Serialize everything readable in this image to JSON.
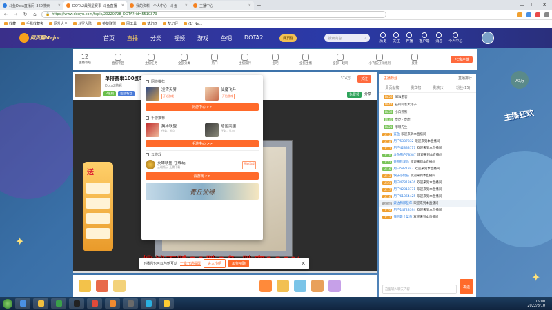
{
  "browser": {
    "tabs": [
      {
        "title": "斗鱼Dota直播间_360搜索",
        "active": false
      },
      {
        "title": "DOTA2最明星赛事_斗鱼直播",
        "active": true
      },
      {
        "title": "我的资料 - 个人中心 - 斗鱼",
        "active": false
      },
      {
        "title": "主播中心",
        "active": false
      }
    ],
    "url": "https://www.douyu.com/topic/20220728_DOTA?rid=5510379",
    "bookmarks": [
      "收藏",
      "手机收藏夹",
      "网址大全",
      "斗罗大陆",
      "英雄联盟",
      "图工具",
      "梦幻西",
      "梦幻经",
      "(1) Ne..."
    ]
  },
  "site": {
    "logo_text": "网页翻Major",
    "nav": [
      "首页",
      "直播",
      "分类",
      "视频",
      "游戏",
      "鱼吧",
      "DOTA2"
    ],
    "nav_active": "直播",
    "vip_pill": "网页翻",
    "search_placeholder": "搜索内容",
    "top_icons": [
      "历史",
      "关注",
      "开播",
      "客户端",
      "消息",
      "个人中心"
    ]
  },
  "substrip": {
    "items": [
      {
        "value": "12",
        "label": "主播等级"
      },
      {
        "value": "",
        "label": "直播专区"
      },
      {
        "value": "",
        "label": "主播任务"
      },
      {
        "value": "",
        "label": "全部分类"
      },
      {
        "value": "",
        "label": "热门"
      },
      {
        "value": "",
        "label": "主播排行"
      },
      {
        "value": "",
        "label": "鱼吧"
      },
      {
        "value": "",
        "label": "全民主播"
      },
      {
        "value": "",
        "label": "全部一起玩"
      },
      {
        "value": "",
        "label": "小飞猫分润规则"
      },
      {
        "value": "",
        "label": "反馈"
      },
      {
        "value": "",
        "label": "更多"
      }
    ],
    "hot_button": "PC客户端"
  },
  "stream": {
    "title": "单排赛事100胜5",
    "subtitle": "Dota2精彩",
    "follow_label": "关注",
    "follow_count": "374万",
    "tags": [
      "V级别",
      "超级粉丝"
    ],
    "share_label": "分享",
    "free_gift_label": "免费领",
    "caption": "挑战百胜21胜0负 胜率100%"
  },
  "popup": {
    "section_web": "网游推荐",
    "web_games": [
      {
        "name": "凌霄天界",
        "badge": "开始游戏"
      },
      {
        "name": "仙魔飞升",
        "badge": "开始游戏"
      }
    ],
    "web_button": "网游中心 >>",
    "section_mobile": "手游推荐",
    "mobile_games": [
      {
        "name": "英雄联盟...",
        "sub": "任务：礼包"
      },
      {
        "name": "暗区突围",
        "sub": "任务：礼包"
      }
    ],
    "mobile_button": "手游中心 >>",
    "section_cloud": "云游戏",
    "cloud_game": {
      "name": "英雄联盟-在线玩",
      "sub": "云端畅玩 无需下载",
      "badge": "开始游戏"
    },
    "cloud_button": "云游戏 >>",
    "banner_text": "青丘仙缘"
  },
  "notice": {
    "text": "下播后也可以与他互动",
    "link": "一键开通提醒",
    "btn1": "进入小组",
    "btn2": "加鱼吧聊"
  },
  "chat": {
    "tabs": [
      "主播粉丝",
      "直播排行"
    ],
    "active_tab": "主播粉丝",
    "subtabs": [
      "周贡献榜",
      "贵宾榜",
      "贵族(1)",
      "粉丝(15)"
    ],
    "ranks": [
      {
        "lvl": "LV.56",
        "name": "SEN游客"
      },
      {
        "lvl": "LV.44",
        "name": "石砖刺客大佬子"
      },
      {
        "lvl": "LV.32",
        "name": "小白熊熊"
      },
      {
        "lvl": "LV.30",
        "name": "虎虎 · 虎虎"
      },
      {
        "lvl": "LV.21",
        "name": "嘟嘟先生"
      }
    ],
    "messages": [
      {
        "lvl": "LV.12",
        "user": "鲨鱼",
        "text": "欢迎来到本直播间"
      },
      {
        "lvl": "LV.18",
        "user": "用户5387832",
        "text": "欢迎来到本直播间"
      },
      {
        "lvl": "LV.11",
        "user": "用户42833717",
        "text": "欢迎来到本直播间"
      },
      {
        "lvl": "LV.10",
        "user": "斗鱼用户78587",
        "text": "欢迎来到本直播间"
      },
      {
        "lvl": "LV.22",
        "user": "哥哥我爱你",
        "text": "欢迎来到本直播间"
      },
      {
        "lvl": "LV.16",
        "user": "用户5821347",
        "text": "欢迎来到本直播间"
      },
      {
        "lvl": "LV.13",
        "user": "快乐小奶猫",
        "text": "欢迎来到本直播间"
      },
      {
        "lvl": "LV.21",
        "user": "用户47813636",
        "text": "欢迎来到本直播间"
      },
      {
        "lvl": "LV.17",
        "user": "用户42813771",
        "text": "欢迎来到本直播间"
      },
      {
        "lvl": "LV.16",
        "user": "用户61364425",
        "text": "欢迎来到本直播间"
      },
      {
        "lvl": "LV.30",
        "user": "渡边和那些年",
        "text": "欢迎来到本直播间"
      },
      {
        "lvl": "LV.24",
        "user": "用户14723394",
        "text": "欢迎来到本直播间"
      },
      {
        "lvl": "LV.12",
        "user": "俺只是个菜鸟",
        "text": "欢迎来到本直播间"
      }
    ],
    "input_placeholder": "这里输入聊天内容",
    "send_label": "发送"
  },
  "online_badge": "70万",
  "right_logo": "主播狂欢",
  "taskbar": {
    "time": "15:00",
    "date": "2022/8/10"
  },
  "colors": {
    "accent": "#ff6a2a",
    "site_header": "#2a3aa8"
  }
}
